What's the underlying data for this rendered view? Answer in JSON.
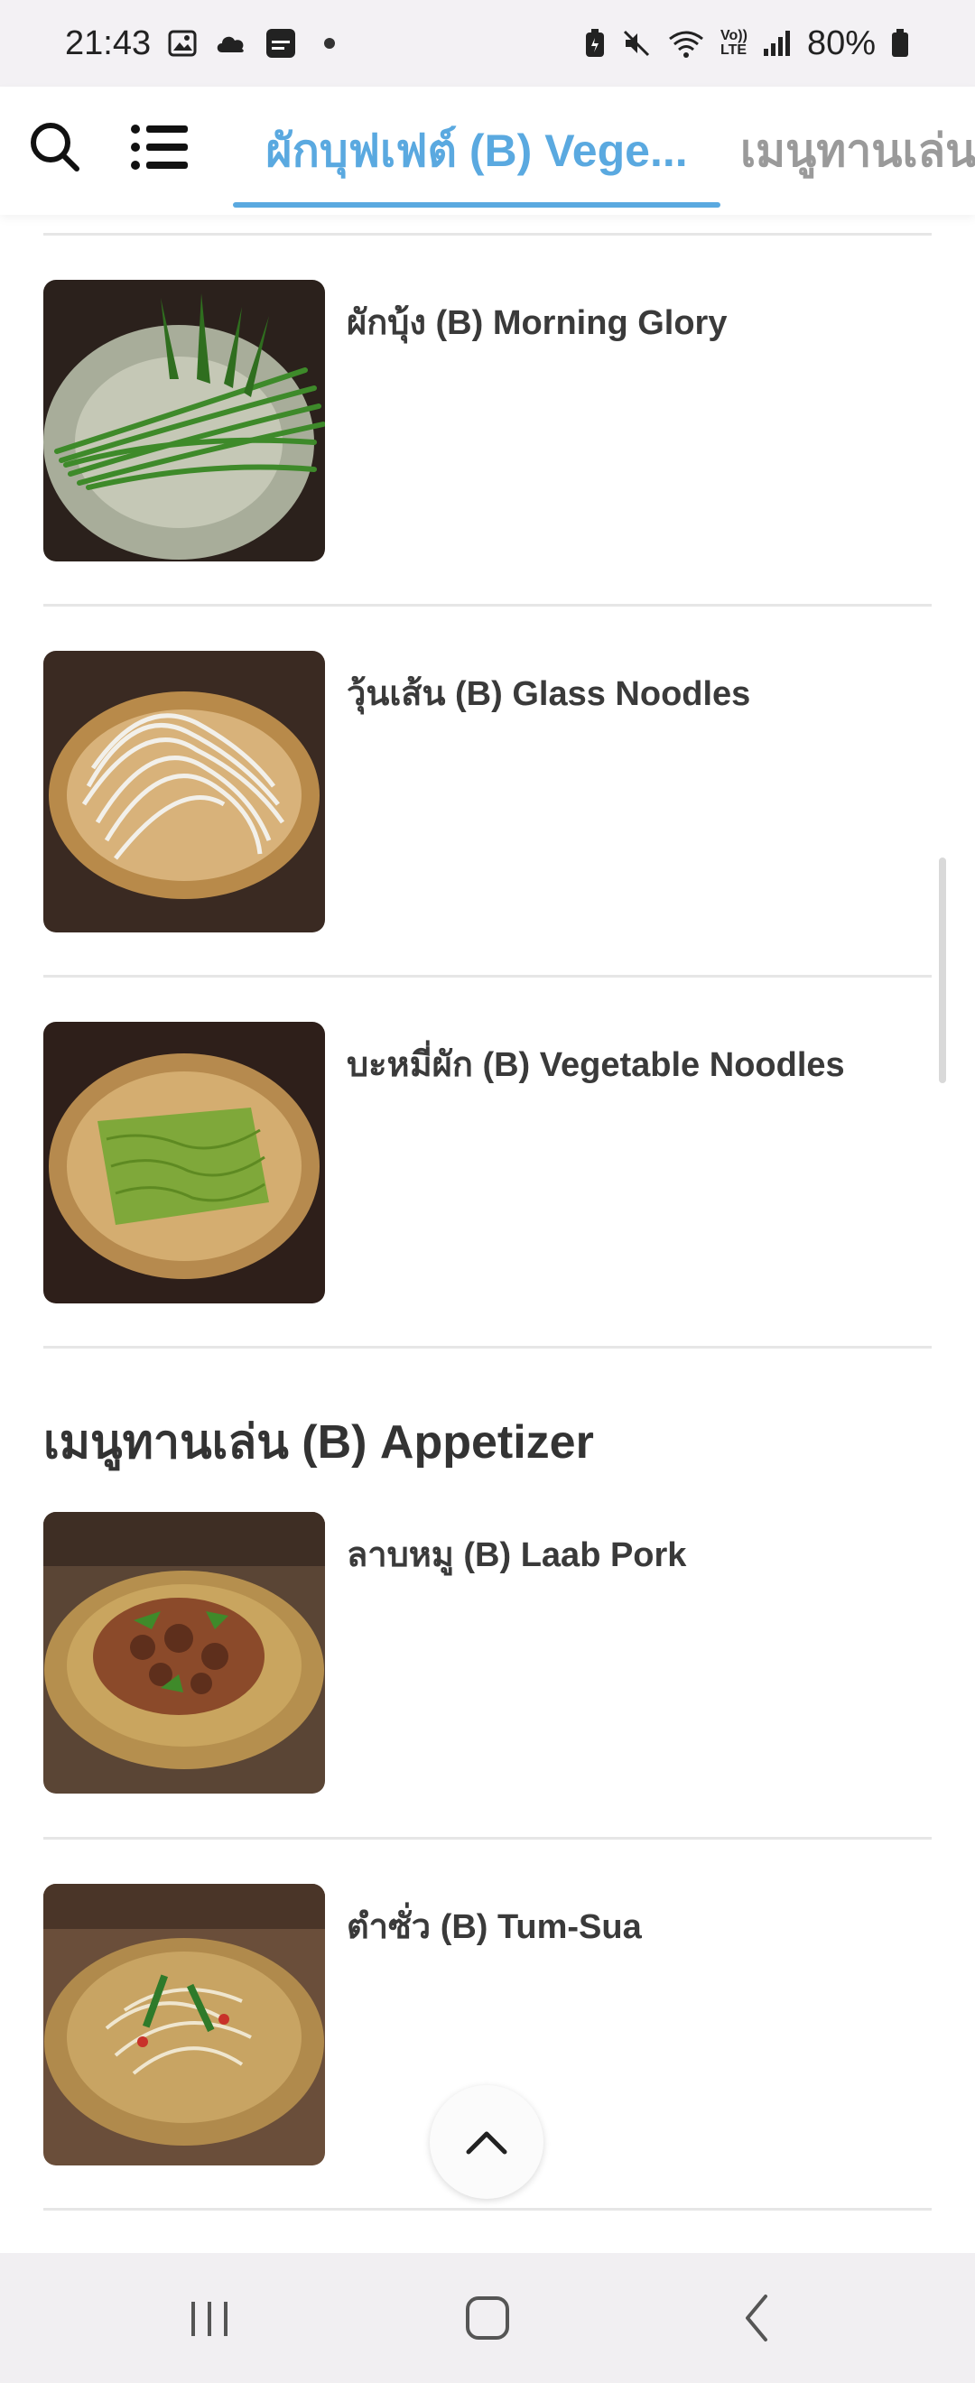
{
  "status_bar": {
    "time": "21:43",
    "battery_percent": "80%",
    "lte_label": "LTE",
    "volte_label": "Vo))",
    "icons": [
      "gallery-icon",
      "cloud-icon",
      "samsung-notes-icon",
      "notification-dot-icon",
      "battery-saver-icon",
      "mute-icon",
      "wifi-icon",
      "volte-icon",
      "signal-icon",
      "battery-icon"
    ]
  },
  "tabs": {
    "active_label": "ผักบุฟเฟต์ (B) Vege...",
    "next_label": "เมนูทานเล่น",
    "accent_color": "#5aa9e0"
  },
  "items": [
    {
      "title": "ผักบุ้ง (B) Morning Glory"
    },
    {
      "title": "วุ้นเส้น (B) Glass Noodles"
    },
    {
      "title": "บะหมี่ผัก (B) Vegetable Noodles"
    }
  ],
  "section": {
    "title": "เมนูทานเล่น (B) Appetizer"
  },
  "appetizer_items": [
    {
      "title": "ลาบหมู (B) Laab Pork"
    },
    {
      "title": "ตำซั่ว (B) Tum-Sua"
    }
  ],
  "navbar": {
    "icons": [
      "recent-apps-icon",
      "home-icon",
      "back-icon"
    ]
  }
}
